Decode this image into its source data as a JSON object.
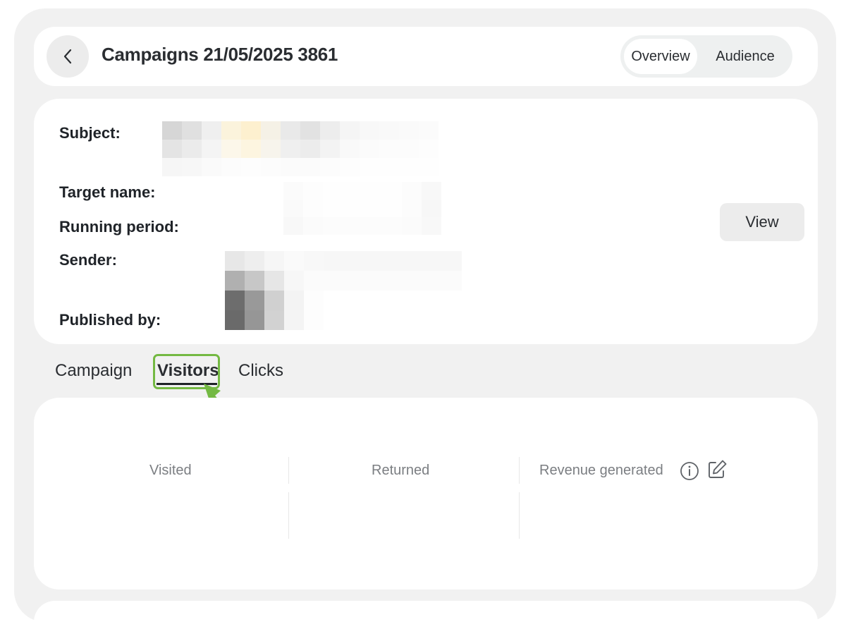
{
  "header": {
    "title": "Campaigns 21/05/2025 3861",
    "tabs": {
      "overview": "Overview",
      "audience": "Audience"
    },
    "active_tab": "Overview"
  },
  "details": {
    "subject_label": "Subject:",
    "target_name_label": "Target name:",
    "running_period_label": "Running period:",
    "sender_label": "Sender:",
    "published_by_label": "Published by:",
    "view_button": "View"
  },
  "content_tabs": {
    "campaign": "Campaign",
    "visitors": "Visitors",
    "clicks": "Clicks",
    "active": "Visitors"
  },
  "stats": {
    "visited": "Visited",
    "returned": "Returned",
    "revenue_generated": "Revenue generated"
  },
  "colors": {
    "background": "#f1f1f1",
    "card": "#ffffff",
    "highlight": "#74b943",
    "muted_text": "#7b7e82"
  },
  "icons": [
    "chevron-left-icon",
    "info-icon",
    "edit-icon",
    "arrow-pointer-icon"
  ]
}
